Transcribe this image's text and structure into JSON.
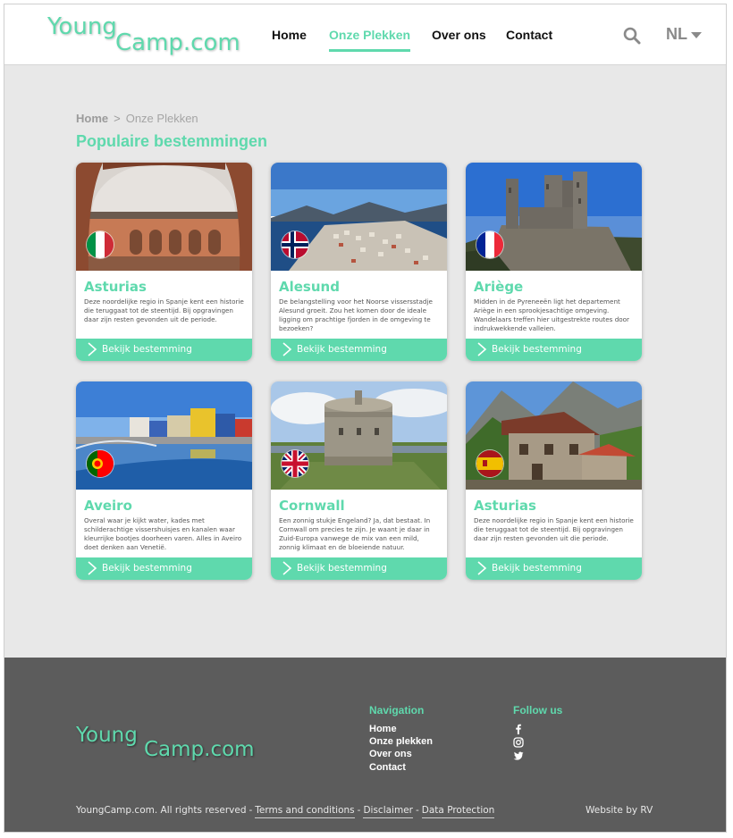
{
  "header": {
    "logo_part1": "Young",
    "logo_part2": "Camp.com",
    "nav": [
      {
        "label": "Home"
      },
      {
        "label": "Onze Plekken",
        "active": true
      },
      {
        "label": "Over ons"
      },
      {
        "label": "Contact"
      }
    ],
    "language": "NL"
  },
  "breadcrumb": {
    "home": "Home",
    "separator": ">",
    "current": "Onze Plekken"
  },
  "page_title": "Populaire bestemmingen",
  "cards": [
    {
      "title": "Asturias",
      "text": "Deze noordelijke regio in Spanje kent een historie die teruggaat tot de steentijd. Bij opgravingen daar zijn resten gevonden uit de periode.",
      "flag": "italy-flag-icon",
      "button": "Bekijk bestemming"
    },
    {
      "title": "Alesund",
      "text": "De belangstelling voor het Noorse vissersstadje Alesund groeit. Zou het komen door de ideale ligging om prachtige fjorden in de omgeving te bezoeken?",
      "flag": "norway-flag-icon",
      "button": "Bekijk bestemming"
    },
    {
      "title": "Ariège",
      "text": "Midden in de Pyreneeën ligt het departement Ariège in een sprookjesachtige omgeving. Wandelaars treffen hier uitgestrekte routes door indrukwekkende valleien.",
      "flag": "france-flag-icon",
      "button": "Bekijk bestemming"
    },
    {
      "title": "Aveiro",
      "text": "Overal waar je kijkt water, kades met schilderachtige vissershuisjes en kanalen waar kleurrijke bootjes doorheen varen. Alles in Aveiro doet denken aan Venetië.",
      "flag": "portugal-flag-icon",
      "button": "Bekijk bestemming"
    },
    {
      "title": "Cornwall",
      "text": "Een zonnig stukje Engeland? Ja, dat bestaat. In Cornwall om precies te zijn. Je waant je daar in Zuid-Europa vanwege de mix van een mild, zonnig klimaat en de bloeiende natuur.",
      "flag": "uk-flag-icon",
      "button": "Bekijk bestemming"
    },
    {
      "title": "Asturias",
      "text": "Deze noordelijke regio in Spanje kent een historie die teruggaat tot de steentijd. Bij opgravingen daar zijn resten gevonden uit die periode.",
      "flag": "spain-flag-icon",
      "button": "Bekijk bestemming"
    }
  ],
  "footer": {
    "logo_part1": "Young",
    "logo_part2": "Camp.com",
    "navigation_title": "Navigation",
    "navigation_links": [
      "Home",
      "Onze plekken",
      "Over ons",
      "Contact"
    ],
    "follow_title": "Follow us",
    "social_icons": [
      "facebook-icon",
      "instagram-icon",
      "twitter-icon"
    ],
    "copyright": "YoungCamp.com. All rights reserved",
    "separator": "-",
    "legal_links": [
      "Terms and conditions",
      "Disclaimer",
      "Data Protection"
    ],
    "credit": "Website by RV"
  },
  "colors": {
    "accent": "#5fd9ad",
    "footer_bg": "#5c5c5c",
    "page_bg": "#e8e8e8"
  }
}
